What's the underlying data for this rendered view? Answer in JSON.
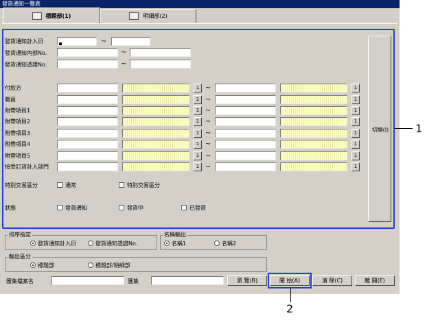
{
  "window": {
    "title": "發貨通知一覽表"
  },
  "tabs": [
    {
      "label": "標題部(1)",
      "icon": "book-icon"
    },
    {
      "label": "明細部(2)",
      "icon": "document-icon"
    }
  ],
  "date_fields": [
    {
      "label": "發貨通知計入日"
    },
    {
      "label": "發貨通知內部No."
    },
    {
      "label": "發貨通知憑證No."
    }
  ],
  "range_sep": "~",
  "code_fields": [
    {
      "label": "付款方"
    },
    {
      "label": "職員"
    },
    {
      "label": "附帶項目1"
    },
    {
      "label": "附帶項目2"
    },
    {
      "label": "附帶項目3"
    },
    {
      "label": "附帶項目4"
    },
    {
      "label": "附帶項目5"
    },
    {
      "label": "接受訂貨計入部門"
    }
  ],
  "small_button_label": "1",
  "special_trade": {
    "label": "特別交易區分",
    "options": [
      "通常",
      "特別交易區分"
    ]
  },
  "status": {
    "label": "狀態",
    "options": [
      "發貨通知",
      "發貨中",
      "已發貨"
    ]
  },
  "switch_button": "切換(I)",
  "sort": {
    "title": "排序指定",
    "options": [
      "發貨通知計入日",
      "發貨通知憑證No."
    ],
    "selected": 0
  },
  "name_output": {
    "title": "名稱輸出",
    "options": [
      "名稱1",
      "名稱2"
    ],
    "selected": 0
  },
  "output_section": {
    "title": "輸出區分",
    "options": [
      "標題部",
      "標題部/明細部"
    ],
    "selected": 0
  },
  "file": {
    "label": "匯集檔案名",
    "label2": "匯集"
  },
  "buttons": {
    "browse": "瀏 覽(B)",
    "start": "開 始(A)",
    "clear": "清 除(C)",
    "close": "離 開(E)"
  },
  "callouts": [
    "1",
    "2"
  ],
  "colors": {
    "highlight": "#1f3fd6",
    "titlebar": "#0a246a",
    "yellow_field": "#ffffc0"
  }
}
